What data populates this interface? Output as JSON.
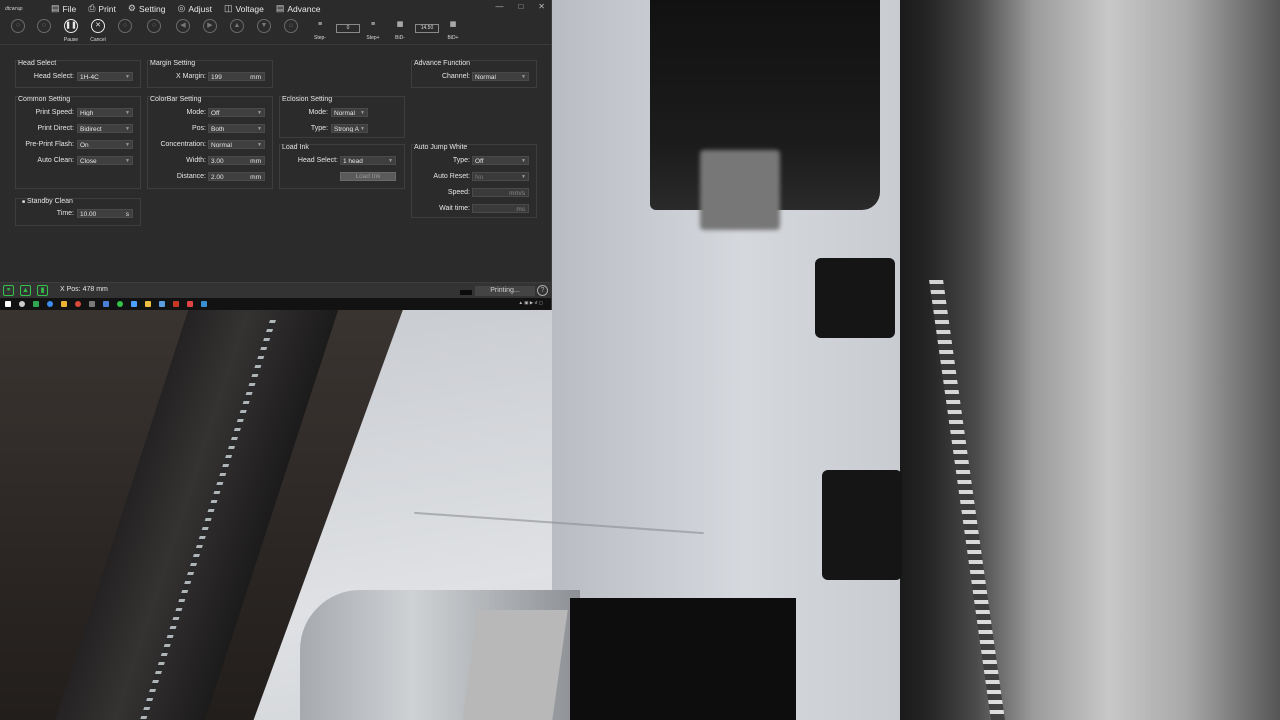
{
  "app": {
    "logo": "dtcwrap",
    "menu": [
      {
        "icon": "file-icon",
        "label": "File"
      },
      {
        "icon": "print-icon",
        "label": "Print"
      },
      {
        "icon": "gear-icon",
        "label": "Setting"
      },
      {
        "icon": "adjust-icon",
        "label": "Adjust"
      },
      {
        "icon": "voltage-icon",
        "label": "Voltage"
      },
      {
        "icon": "advance-icon",
        "label": "Advance"
      }
    ],
    "toolbar": {
      "pause": "Pause",
      "cancel": "Cancel",
      "step_minus": "Step-",
      "step_value": "0",
      "step_plus": "Step+",
      "bid_minus": "BiD-",
      "bid_value": "14.50",
      "bid_plus": "BiD+"
    },
    "head_select": {
      "title": "Head Select",
      "label": "Head Select:",
      "value": "1H-4C"
    },
    "margin_setting": {
      "title": "Margin Setting",
      "label": "X Margin:",
      "value": "199",
      "unit": "mm"
    },
    "advance_function": {
      "title": "Advance Function",
      "label": "Channel:",
      "value": "Normal"
    },
    "common_setting": {
      "title": "Common Setting",
      "print_speed_label": "Print Speed:",
      "print_speed": "High",
      "print_direct_label": "Print Direct:",
      "print_direct": "Bidirect",
      "pre_print_flash_label": "Pre-Print Flash:",
      "pre_print_flash": "On",
      "auto_clean_label": "Auto Clean:",
      "auto_clean": "Close"
    },
    "colorbar_setting": {
      "title": "ColorBar Setting",
      "mode_label": "Mode:",
      "mode": "Off",
      "pos_label": "Pos:",
      "pos": "Both",
      "concentration_label": "Concentration:",
      "concentration": "Normal",
      "width_label": "Width:",
      "width": "3.00",
      "width_unit": "mm",
      "distance_label": "Distance:",
      "distance": "2.00",
      "distance_unit": "mm"
    },
    "eclosion_setting": {
      "title": "Eclosion Setting",
      "mode_label": "Mode:",
      "mode": "Normal",
      "type_label": "Type:",
      "type": "Strong A"
    },
    "load_ink": {
      "title": "Load Ink",
      "label": "Head Select:",
      "value": "1 head",
      "button": "Load Ink"
    },
    "auto_jump_white": {
      "title": "Auto Jump White",
      "type_label": "Type:",
      "type": "Off",
      "auto_reset_label": "Auto Reset:",
      "auto_reset": "No",
      "speed_label": "Speed:",
      "speed_unit": "mm/s",
      "wait_time_label": "Wait time:",
      "wait_time_unit": "ms"
    },
    "standby_clean": {
      "title": "Standby Clean",
      "time_label": "Time:",
      "time": "10.00",
      "time_unit": "s"
    },
    "status": {
      "x_pos": "X Pos: 478 mm",
      "state": "Printing..."
    },
    "colors": {
      "accent_green": "#35c24a",
      "panel_bg": "#2b2b2b"
    }
  }
}
